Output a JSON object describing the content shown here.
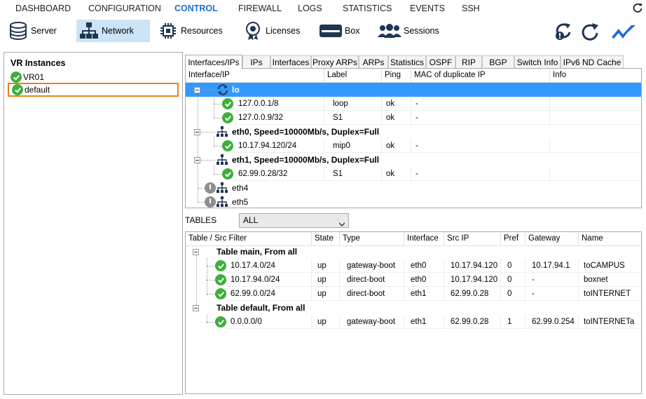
{
  "topnav": {
    "items": [
      "DASHBOARD",
      "CONFIGURATION",
      "CONTROL",
      "FIREWALL",
      "LOGS",
      "STATISTICS",
      "EVENTS",
      "SSH"
    ],
    "active": "CONTROL"
  },
  "toolbar": {
    "buttons": [
      "Server",
      "Network",
      "Resources",
      "Licenses",
      "Box",
      "Sessions"
    ],
    "active": "Network"
  },
  "vr": {
    "title": "VR Instances",
    "items": [
      "VR01",
      "default"
    ]
  },
  "tabs": [
    "Interfaces/IPs",
    "IPs",
    "Interfaces",
    "Proxy ARPs",
    "ARPs",
    "Statistics",
    "OSPF",
    "RIP",
    "BGP",
    "Switch Info",
    "IPv6 ND Cache"
  ],
  "interfaces": {
    "headers": [
      "Interface/IP",
      "Label",
      "Ping",
      "MAC of duplicate IP",
      "Info"
    ],
    "lo": "lo",
    "lo_rows": [
      {
        "ip": "127.0.0.1/8",
        "label": "loop",
        "ping": "ok",
        "mac": "-"
      },
      {
        "ip": "127.0.0.9/32",
        "label": "S1",
        "ping": "ok",
        "mac": "-"
      }
    ],
    "eth0": "eth0, Speed=10000Mb/s, Duplex=Full",
    "eth0_rows": [
      {
        "ip": "10.17.94.120/24",
        "label": "mip0",
        "ping": "ok",
        "mac": "-"
      }
    ],
    "eth1": "eth1, Speed=10000Mb/s, Duplex=Full",
    "eth1_rows": [
      {
        "ip": "62.99.0.28/32",
        "label": "S1",
        "ping": "ok",
        "mac": "-"
      }
    ],
    "eth4": "eth4",
    "eth5": "eth5"
  },
  "tables": {
    "label": "TABLES",
    "selected": "ALL",
    "headers": [
      "Table / Src Filter",
      "State",
      "Type",
      "Interface",
      "Src IP",
      "Pref",
      "Gateway",
      "Name"
    ],
    "main_group": "Table main, From all",
    "main_rows": [
      {
        "dest": "10.17.4.0/24",
        "state": "up",
        "type": "gateway-boot",
        "iface": "eth0",
        "src": "10.17.94.120",
        "pref": "0",
        "gw": "10.17.94.1",
        "name": "toCAMPUS"
      },
      {
        "dest": "10.17.94.0/24",
        "state": "up",
        "type": "direct-boot",
        "iface": "eth0",
        "src": "10.17.94.120",
        "pref": "0",
        "gw": "-",
        "name": "boxnet"
      },
      {
        "dest": "62.99.0.0/24",
        "state": "up",
        "type": "direct-boot",
        "iface": "eth1",
        "src": "62.99.0.28",
        "pref": "0",
        "gw": "-",
        "name": "toINTERNET"
      }
    ],
    "default_group": "Table default, From all",
    "default_rows": [
      {
        "dest": "0.0.0.0/0",
        "state": "up",
        "type": "gateway-boot",
        "iface": "eth1",
        "src": "62.99.0.28",
        "pref": "1",
        "gw": "62.99.0.254",
        "name": "toINTERNETa"
      }
    ]
  }
}
